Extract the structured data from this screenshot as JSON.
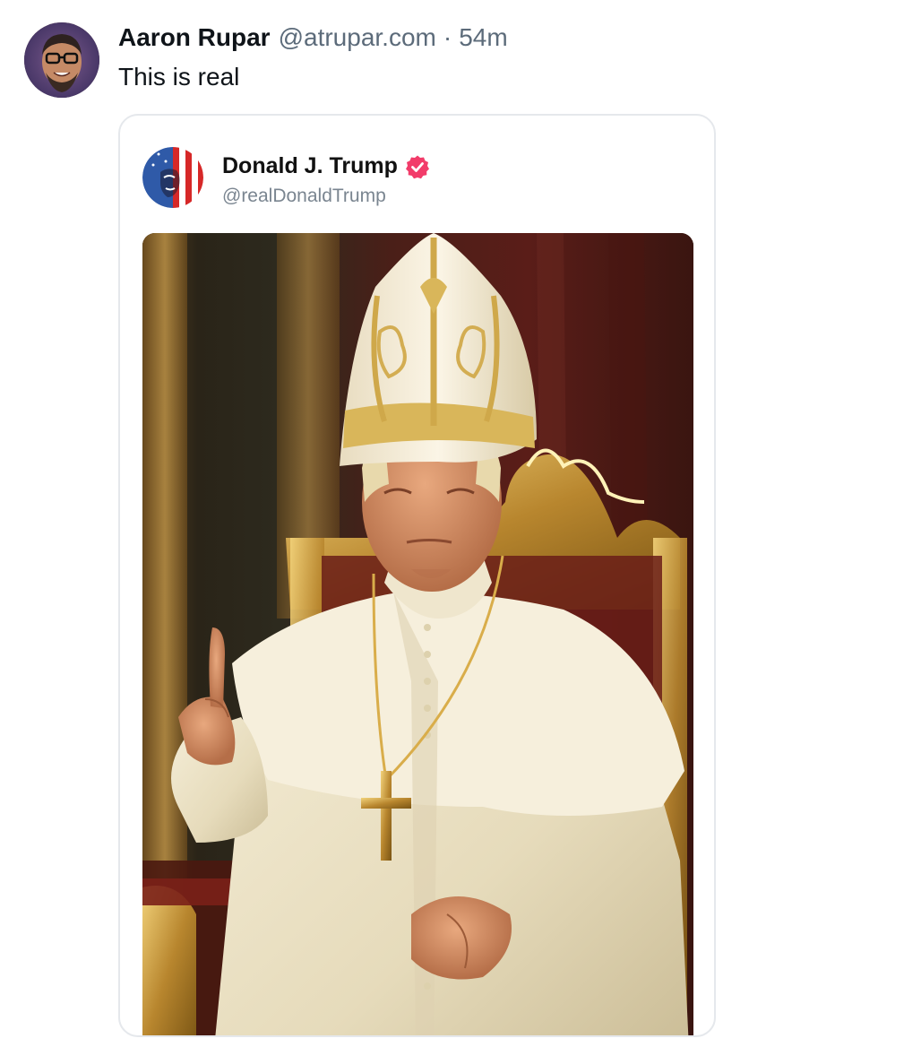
{
  "post": {
    "author_name": "Aaron Rupar",
    "author_handle": "@atrupar.com",
    "separator": "·",
    "timestamp": "54m",
    "text": "This is real",
    "avatar_icon": "user-avatar-photo"
  },
  "embed": {
    "author_name": "Donald J. Trump",
    "author_handle": "@realDonaldTrump",
    "verified_icon": "verified-badge-icon",
    "verified_color": "#f23c6a",
    "avatar_icon": "flag-face-avatar",
    "image_icon": "pope-portrait-image"
  },
  "colors": {
    "text_primary": "#0f1419",
    "text_secondary": "#5c6b7a",
    "border": "#e5e8ec",
    "background": "#ffffff"
  }
}
